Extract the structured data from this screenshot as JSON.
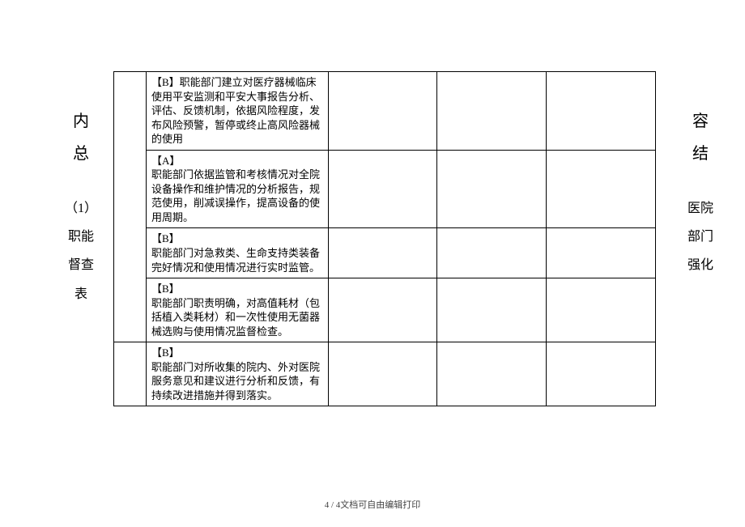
{
  "left_column": {
    "char1": "内",
    "char2": "总",
    "line1": "（1）",
    "line2": "职能",
    "line3": "督查",
    "line4": "表"
  },
  "right_column": {
    "char1": "容",
    "char2": "结",
    "line1": "医院",
    "line2": "部门",
    "line3": "强化"
  },
  "table": {
    "rows": [
      {
        "text": "【B】职能部门建立对医疗器械临床使用平安监测和平安大事报告分析、评估、反馈机制，依据风险程度，发布风险预警，暂停或终止高风险器械的使用"
      },
      {
        "text": "【A】\n职能部门依据监管和考核情况对全院设备操作和维护情况的分析报告，规范使用，削减误操作，提高设备的使用周期。"
      },
      {
        "text": "【B】\n职能部门对急救类、生命支持类装备完好情况和使用情况进行实时监管。"
      },
      {
        "text": "【B】\n职能部门职责明确，对高值耗材（包括植入类耗材）和一次性使用无菌器械选购与使用情况监督检查。"
      },
      {
        "text": "【B】\n职能部门对所收集的院内、外对医院服务意见和建议进行分析和反馈，有持续改进措施并得到落实。"
      }
    ]
  },
  "footer": "4 / 4文档可自由编辑打印"
}
